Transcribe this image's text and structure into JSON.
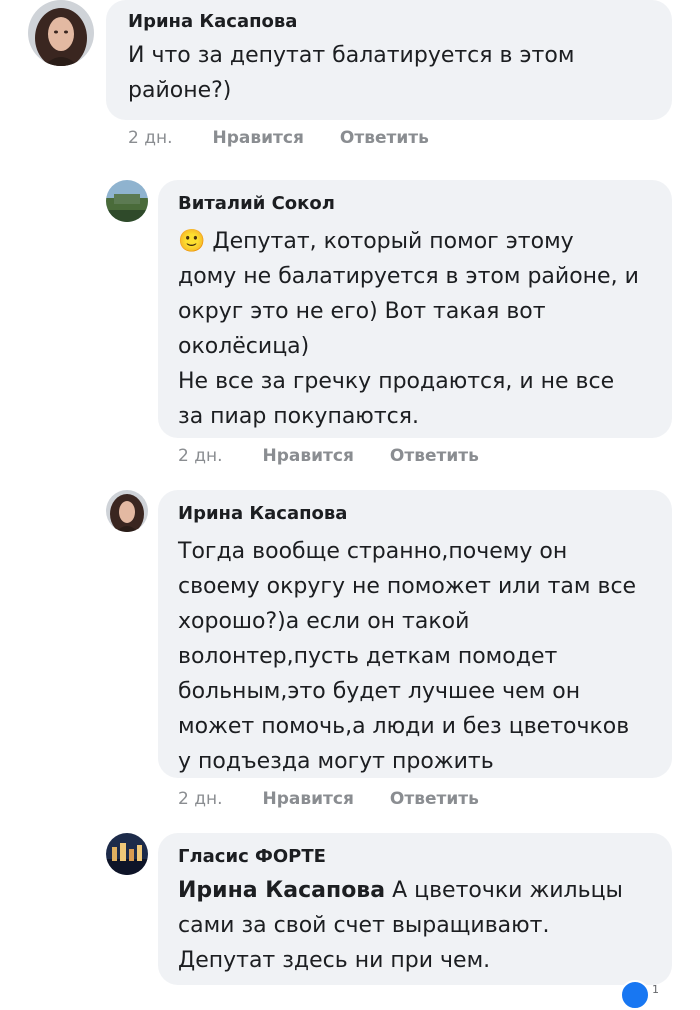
{
  "comments": [
    {
      "author": "Ирина Касапова",
      "text": "И что за депутат балатируется в этом\nрайоне?)",
      "age": "2 дн.",
      "like": "Нравится",
      "reply": "Ответить"
    },
    {
      "author": "Виталий Сокол",
      "emoji": "🙂",
      "text": " Депутат, который помог этому\nдому не балатируется в этом районе, и\nокруг это не его) Вот такая вот\nоколёсица)\nНе все за гречку продаются, и не все\nза пиар покупаются.",
      "age": "2 дн.",
      "like": "Нравится",
      "reply": "Ответить"
    },
    {
      "author": "Ирина Касапова",
      "text": "Тогда вообще странно,почему он\nсвоему округу не поможет или там все\nхорошо?)а если он такой\nволонтер,пусть деткам помодет\nбольным,это будет лучшее     чем он\nможет помочь,а люди и без цветочков\nу подъезда могут прожить",
      "age": "2 дн.",
      "like": "Нравится",
      "reply": "Ответить"
    },
    {
      "author": "Гласис ФОРТЕ",
      "mention": "Ирина Касапова",
      "text": " А цветочки жильцы\nсами за свой счет выращивают.\nДепутат здесь ни при чем."
    }
  ],
  "reaction": {
    "icon": "like-reaction-icon",
    "count": "1",
    "color": "#1877f2"
  }
}
